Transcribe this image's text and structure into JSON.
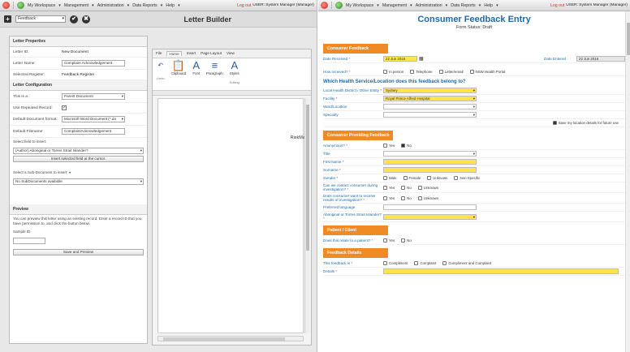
{
  "nav": {
    "items": [
      "My Workspace",
      "Management",
      "Administration",
      "Data Reports",
      "Help"
    ],
    "logout": "Log out",
    "user_line1": "USER: System Manager (Manager)"
  },
  "left": {
    "toolbar": {
      "select_value": "Feedback",
      "title": "Letter Builder"
    },
    "props": {
      "section1": "Letter Properties",
      "letter_id_label": "Letter ID:",
      "letter_id_value": "New Document",
      "letter_name_label": "Letter Name:",
      "letter_name_value": "Complaint Acknowledgement",
      "register_label": "Selected Register:",
      "register_value": "Feedback Register",
      "section2": "Letter Configuration",
      "this_is_label": "This is a :",
      "this_is_value": "Parent Document",
      "use_record_label": "Use Repeated Record:",
      "default_format_label": "Default Document format:",
      "default_format_value": "Microsoft Word Document (*.do",
      "default_filename_label": "Default Filename:",
      "default_filename_value": "ComplaintAcknowledgement",
      "select_field_label": "Select field to insert:",
      "select_field_value": "(Author) Aboriginal or Torres Strait Islander?",
      "insert_button": "Insert selected field at the cursor.",
      "subdoc_label": "Select a Sub-Document to insert:",
      "subdoc_value": "No SubDocuments available",
      "preview_section": "Preview",
      "preview_text": "You can preview this letter using an existing record. Enter a record ID that you have permission to, and click the button below.",
      "sample_label": "Sample ID",
      "save_button": "Save and Preview"
    },
    "ribbon": {
      "tabs": [
        "File",
        "Home",
        "Insert",
        "Page Layout",
        "View"
      ],
      "groups": [
        "Clipboard",
        "Font",
        "Paragraph",
        "Styles"
      ],
      "undo_label": "Undo",
      "editing_label": "Editing"
    },
    "doc_text": "RiskMan"
  },
  "right": {
    "title": "Consumer Feedback Entry",
    "status": "Form Status: Draft",
    "sec_consumer": "Consumer Feedback",
    "date_received_label": "Date Received",
    "date_received_value": "22 Jun 2016",
    "date_entered_label": "Date Entered",
    "date_entered_value": "22 Jun 2016",
    "how_received_label": "How received?",
    "how_received_opts": [
      "In person",
      "Telephone",
      "Letter/email",
      "NSW Health Portal"
    ],
    "question": "Which Health Service/Location does this feedback belong to?",
    "lhd_label": "Local Health District / Other Entity",
    "lhd_value": "Sydney",
    "facility_label": "Facility",
    "facility_value": "Royal Prince Alfred Hospital",
    "ward_label": "Ward/Location",
    "specialty_label": "Specialty",
    "save_loc_label": "Save my location details for future use",
    "sec_providing": "Consumer Providing Feedback",
    "anon_label": "Anonymous?",
    "yes": "Yes",
    "no": "No",
    "unknown": "Unknown",
    "title_label": "Title",
    "first_label": "First Name",
    "surname_label": "Surname",
    "gender_label": "Gender",
    "gender_opts": [
      "Male",
      "Female",
      "Unknown",
      "Non Specific"
    ],
    "contact_label": "Can we contact consumer during investigation?",
    "results_label": "Does consumer want to receive results of investigation?",
    "lang_label": "Preferred language",
    "abor_label": "Aboriginal or Torres Strait Islander?",
    "sec_patient": "Patient / Client",
    "patient_label": "Does this relate to a patient?",
    "sec_details": "Feedback Details",
    "feedback_is_label": "This feedback is",
    "feedback_opts": [
      "Compliment",
      "Complaint",
      "Compliment and Complaint"
    ],
    "details_label": "Details"
  }
}
